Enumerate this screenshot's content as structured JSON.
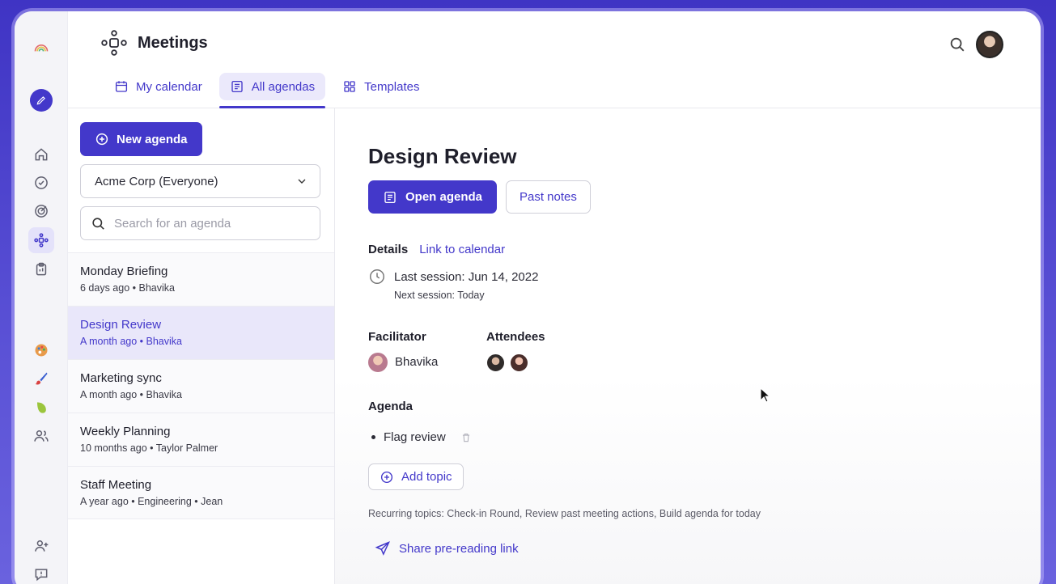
{
  "app": {
    "title": "Meetings"
  },
  "tabs": [
    {
      "label": "My calendar",
      "icon": "calendar-icon",
      "active": false
    },
    {
      "label": "All agendas",
      "icon": "list-icon",
      "active": true
    },
    {
      "label": "Templates",
      "icon": "grid-icon",
      "active": false
    }
  ],
  "sidebar": {
    "new_agenda_label": "New agenda",
    "org_select_value": "Acme Corp (Everyone)",
    "search_placeholder": "Search for an agenda"
  },
  "agendas": [
    {
      "title": "Monday Briefing",
      "meta": "6 days ago • Bhavika",
      "selected": false
    },
    {
      "title": "Design Review",
      "meta": "A month ago • Bhavika",
      "selected": true
    },
    {
      "title": "Marketing sync",
      "meta": "A month ago • Bhavika",
      "selected": false
    },
    {
      "title": "Weekly Planning",
      "meta": "10 months ago • Taylor Palmer",
      "selected": false
    },
    {
      "title": "Staff Meeting",
      "meta": "A year ago • Engineering • Jean",
      "selected": false
    }
  ],
  "detail": {
    "title": "Design Review",
    "open_agenda_label": "Open agenda",
    "past_notes_label": "Past notes",
    "details_label": "Details",
    "link_calendar_label": "Link to calendar",
    "last_session": "Last session: Jun 14, 2022",
    "next_session": "Next session: Today",
    "facilitator_label": "Facilitator",
    "facilitator_name": "Bhavika",
    "attendees_label": "Attendees",
    "agenda_label": "Agenda",
    "topics": [
      "Flag review"
    ],
    "add_topic_label": "Add topic",
    "recurring_topics": "Recurring topics: Check-in Round, Review past meeting actions, Build agenda for today",
    "share_label": "Share pre-reading link"
  },
  "colors": {
    "accent": "#4338ca",
    "selected_bg": "#e9e7fa",
    "background": "#4a3fc8"
  }
}
